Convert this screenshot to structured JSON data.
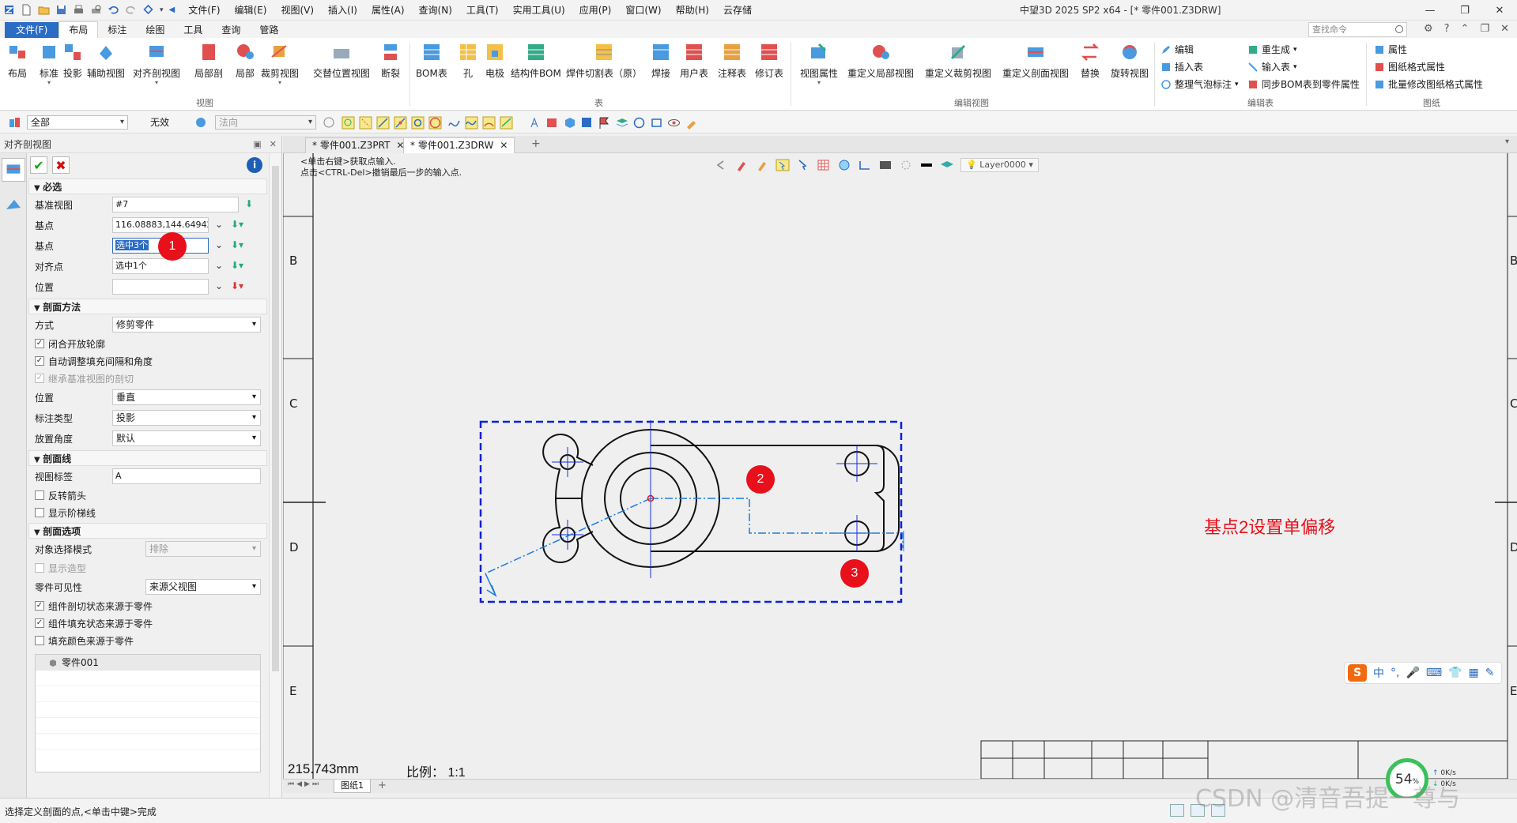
{
  "app": {
    "title": "中望3D 2025 SP2 x64 - [* 零件001.Z3DRW]",
    "menu": [
      "文件(F)",
      "编辑(E)",
      "视图(V)",
      "插入(I)",
      "属性(A)",
      "查询(N)",
      "工具(T)",
      "实用工具(U)",
      "应用(P)",
      "窗口(W)",
      "帮助(H)",
      "云存储"
    ]
  },
  "ribbon_tabs": [
    "文件(F)",
    "布局",
    "标注",
    "绘图",
    "工具",
    "查询",
    "管路"
  ],
  "search_placeholder": "查找命令",
  "ribbon": {
    "view_group": [
      "布局",
      "标准",
      "投影",
      "辅助视图",
      "对齐剖视图",
      "局部剖",
      "局部",
      "裁剪视图",
      "交替位置视图",
      "断裂"
    ],
    "view_group_label": "视图",
    "table_group": [
      "BOM表",
      "孔",
      "电极",
      "结构件BOM",
      "焊件切割表（原）",
      "焊接",
      "用户表",
      "注释表",
      "修订表"
    ],
    "table_group_label": "表",
    "edit_view_group": [
      "视图属性",
      "重定义局部视图",
      "重定义裁剪视图",
      "重定义剖面视图",
      "替换",
      "旋转视图"
    ],
    "edit_view_group_label": "编辑视图",
    "edit_table_col1": [
      "编辑",
      "插入表",
      "整理气泡标注"
    ],
    "edit_table_col2": [
      "重生成",
      "输入表",
      "同步BOM表到零件属性"
    ],
    "edit_table_group_label": "编辑表",
    "sheet_col": [
      "属性",
      "图纸格式属性",
      "批量修改图纸格式属性"
    ],
    "sheet_group_label": "图纸"
  },
  "filter": {
    "all": "全部",
    "invalid": "无效",
    "normal": "法向"
  },
  "panel": {
    "title": "对齐剖视图",
    "sections": {
      "required": "必选",
      "section_method": "剖面方法",
      "section_line": "剖面线",
      "section_options": "剖面选项"
    },
    "required_fields": [
      {
        "label": "基准视图",
        "value": "#7"
      },
      {
        "label": "基点",
        "value": "116.08883,144.64942"
      },
      {
        "label": "基点",
        "value": "选中3个"
      },
      {
        "label": "对齐点",
        "value": "选中1个"
      },
      {
        "label": "位置",
        "value": ""
      }
    ],
    "method": {
      "label": "方式",
      "value": "修剪零件"
    },
    "method_checks": [
      {
        "label": "闭合开放轮廓",
        "checked": true,
        "disabled": false
      },
      {
        "label": "自动调整填充间隔和角度",
        "checked": true,
        "disabled": false
      },
      {
        "label": "继承基准视图的剖切",
        "checked": true,
        "disabled": true
      }
    ],
    "method_fields": [
      {
        "label": "位置",
        "value": "垂直"
      },
      {
        "label": "标注类型",
        "value": "投影"
      },
      {
        "label": "放置角度",
        "value": "默认"
      }
    ],
    "view_label": {
      "label": "视图标签",
      "value": "A"
    },
    "line_checks": [
      {
        "label": "反转箭头",
        "checked": false
      },
      {
        "label": "显示阶梯线",
        "checked": false
      }
    ],
    "option_select_mode": {
      "label": "对象选择模式",
      "value": "排除"
    },
    "option_show_shape": {
      "label": "显示造型",
      "checked": false
    },
    "option_part_visibility": {
      "label": "零件可见性",
      "value": "来源父视图"
    },
    "option_checks": [
      {
        "label": "组件剖切状态来源于零件",
        "checked": true
      },
      {
        "label": "组件填充状态来源于零件",
        "checked": true
      },
      {
        "label": "填充颜色来源于零件",
        "checked": false
      }
    ],
    "part_list": [
      "零件001"
    ]
  },
  "doc_tabs": [
    "* 零件001.Z3PRT",
    "* 零件001.Z3DRW"
  ],
  "canvas": {
    "prompt_line1": "<单击右键>获取点输入.",
    "prompt_line2": "点击<CTRL-Del>撤销最后一步的输入点.",
    "layer": "Layer0000",
    "zone_labels": [
      "B",
      "C",
      "D",
      "E"
    ],
    "annotation": "基点2设置单偏移",
    "badges": [
      "1",
      "2",
      "3"
    ],
    "coord_readout": "215.743mm",
    "scale_readout": "比例：  1:1",
    "sheet_tab": "图纸1"
  },
  "ime": {
    "logo": "S",
    "mode": "中"
  },
  "netmon": {
    "percent": "54",
    "up": "0K/s",
    "down": "0K/s"
  },
  "status": {
    "text": "选择定义剖面的点,<单击中键>完成"
  },
  "watermark": "CSDN @清音吾提一尊与",
  "colors": {
    "accent": "#2b6cc4",
    "badge": "#e8101a",
    "highlight_box": "#0a20d8"
  }
}
